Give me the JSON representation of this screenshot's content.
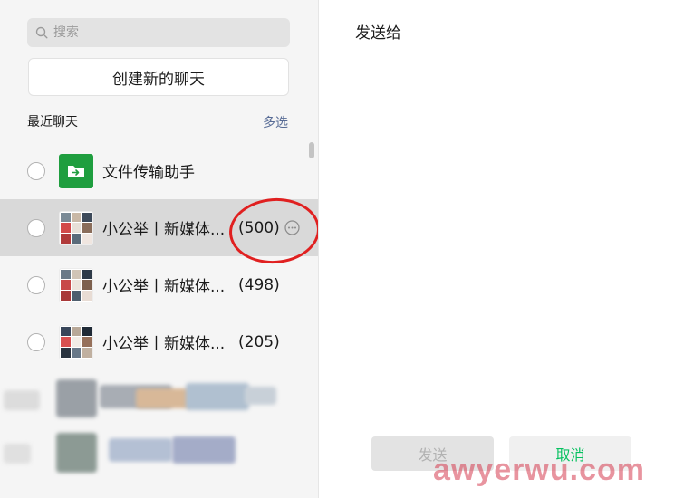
{
  "search": {
    "placeholder": "搜索"
  },
  "new_chat_label": "创建新的聊天",
  "recent": {
    "title": "最近聊天",
    "multi_select_label": "多选"
  },
  "chats": [
    {
      "name": "文件传输助手",
      "count": "",
      "avatar": "file-transfer-icon",
      "selected": false
    },
    {
      "name": "小公举丨新媒体...",
      "count": "(500)",
      "avatar": "group-avatar",
      "selected": true
    },
    {
      "name": "小公举丨新媒体...",
      "count": "(498)",
      "avatar": "group-avatar",
      "selected": false
    },
    {
      "name": "小公举丨新媒体...",
      "count": "(205)",
      "avatar": "group-avatar",
      "selected": false
    }
  ],
  "right": {
    "title": "发送给",
    "send_label": "发送",
    "cancel_label": "取消"
  },
  "watermark": "awyerwu.com",
  "colors": {
    "accent_green": "#07c160",
    "link_blue": "#576b95",
    "annotation_red": "#e02020",
    "file_icon_green": "#1f9e3f"
  }
}
